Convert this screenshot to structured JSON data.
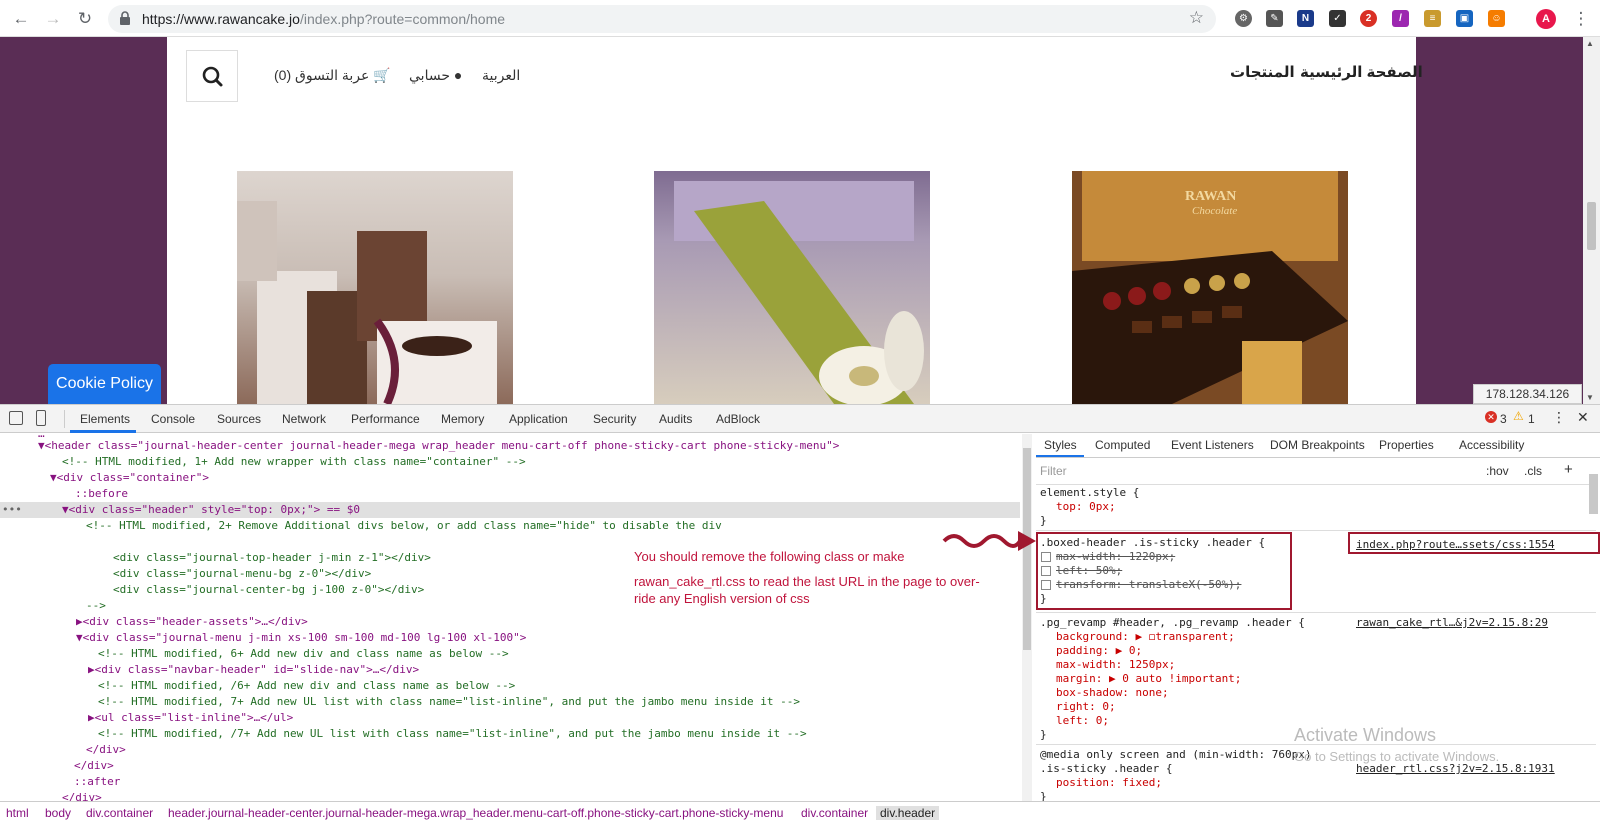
{
  "browser": {
    "url_host": "https://www.rawancake.jo",
    "url_path": "/index.php?route=common/home",
    "profile_initial": "A",
    "ext_badge_count": "2"
  },
  "site": {
    "nav_home": "الصفحة الرئيسية",
    "nav_products": "المنتجات",
    "language": "العربية",
    "account": "حسابي",
    "cart": "عربة التسوق (0)",
    "brand_on_box": "RAWAN",
    "brand_script": "Chocolate"
  },
  "overlay": {
    "cookie_policy": "Cookie Policy",
    "ip_address": "178.128.34.126"
  },
  "devtools": {
    "tabs": [
      "Elements",
      "Console",
      "Sources",
      "Network",
      "Performance",
      "Memory",
      "Application",
      "Security",
      "Audits",
      "AdBlock"
    ],
    "error_count": "3",
    "warning_count": "1",
    "styles_tabs": [
      "Styles",
      "Computed",
      "Event Listeners",
      "DOM Breakpoints",
      "Properties",
      "Accessibility"
    ],
    "filter_placeholder": "Filter",
    "hov": ":hov",
    "cls": ".cls",
    "annotation_line1": "You should remove the following class or make",
    "annotation_line2": "rawan_cake_rtl.css to read the last URL in the page to over-",
    "annotation_line3": "ride any English version of css",
    "breadcrumbs": [
      "html",
      "body",
      "div.container",
      "header.journal-header-center.journal-header-mega.wrap_header.menu-cart-off.phone-sticky-cart.phone-sticky-menu",
      "div.container",
      "div.header"
    ],
    "dom_lines": [
      "▼<header class=\"journal-header-center journal-header-mega wrap_header menu-cart-off phone-sticky-cart phone-sticky-menu\">",
      "<!-- HTML modified, 1+ Add new wrapper with class name=\"container\" -->",
      "▼<div class=\"container\">",
      "::before",
      "▼<div class=\"header\" style=\"top: 0px;\"> == $0",
      "<!-- HTML modified, 2+ Remove Additional divs below, or add class name=\"hide\" to disable the div",
      "",
      "<div class=\"journal-top-header j-min z-1\"></div>",
      "<div class=\"journal-menu-bg z-0\"></div>",
      "<div class=\"journal-center-bg j-100 z-0\"></div>",
      "-->",
      "▶<div class=\"header-assets\">…</div>",
      "▼<div class=\"journal-menu j-min xs-100 sm-100 md-100 lg-100 xl-100\">",
      "<!-- HTML modified, 6+ Add new div and class name as below -->",
      "▶<div class=\"navbar-header\" id=\"slide-nav\">…</div>",
      "<!-- HTML modified, /6+ Add new div and class name as below -->",
      "<!-- HTML modified, 7+ Add new UL list with class name=\"list-inline\", and put the jambo menu inside it -->",
      "▶<ul class=\"list-inline\">…</ul>",
      "<!-- HTML modified, /7+ Add new UL list with class name=\"list-inline\", and put the jambo menu inside it -->",
      "</div>",
      "</div>",
      "::after",
      "</div>"
    ],
    "style_lines": [
      "element.style {",
      "top: 0px;",
      "}",
      ".boxed-header .is-sticky .header {",
      "max-width: 1220px;",
      "left: 50%;",
      "transform: translateX(-50%);",
      "}",
      ".pg_revamp #header, .pg_revamp .header {",
      "background: ▶ ◻transparent;",
      "padding: ▶ 0;",
      "max-width: 1250px;",
      "margin: ▶ 0 auto !important;",
      "box-shadow: none;",
      "right: 0;",
      "left: 0;",
      "}",
      "@media only screen and (min-width: 760px)",
      ".is-sticky .header {",
      "position: fixed;",
      "}"
    ],
    "source_links": [
      "index.php?route…ssets/css:1554",
      "rawan_cake_rtl…&j2v=2.15.8:29",
      "header_rtl.css?j2v=2.15.8:1931"
    ],
    "activate_title": "Activate Windows",
    "activate_sub": "Go to Settings to activate Windows."
  }
}
